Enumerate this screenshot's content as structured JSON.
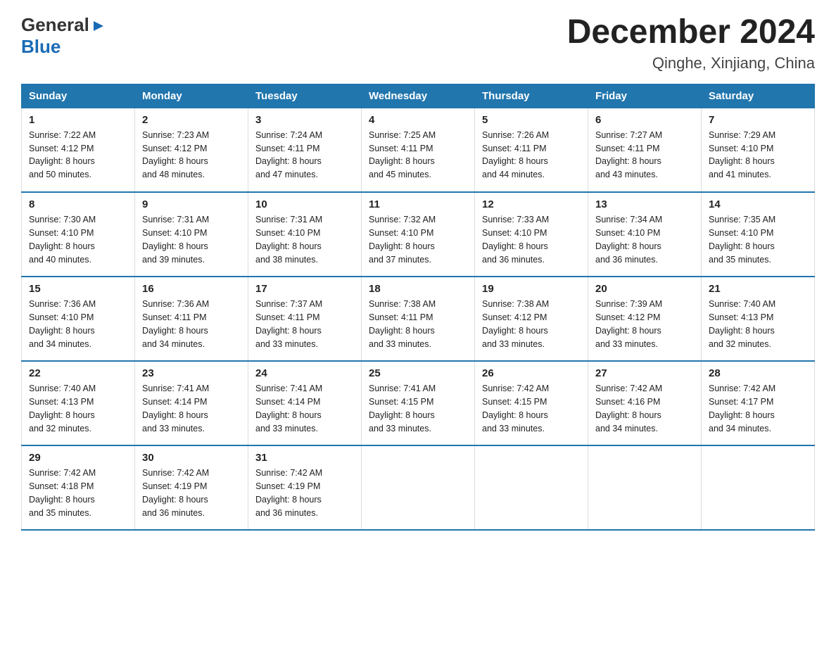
{
  "logo": {
    "general": "General",
    "blue": "Blue",
    "arrow": "▶"
  },
  "title": "December 2024",
  "subtitle": "Qinghe, Xinjiang, China",
  "days_of_week": [
    "Sunday",
    "Monday",
    "Tuesday",
    "Wednesday",
    "Thursday",
    "Friday",
    "Saturday"
  ],
  "weeks": [
    [
      {
        "day": "1",
        "info": "Sunrise: 7:22 AM\nSunset: 4:12 PM\nDaylight: 8 hours\nand 50 minutes."
      },
      {
        "day": "2",
        "info": "Sunrise: 7:23 AM\nSunset: 4:12 PM\nDaylight: 8 hours\nand 48 minutes."
      },
      {
        "day": "3",
        "info": "Sunrise: 7:24 AM\nSunset: 4:11 PM\nDaylight: 8 hours\nand 47 minutes."
      },
      {
        "day": "4",
        "info": "Sunrise: 7:25 AM\nSunset: 4:11 PM\nDaylight: 8 hours\nand 45 minutes."
      },
      {
        "day": "5",
        "info": "Sunrise: 7:26 AM\nSunset: 4:11 PM\nDaylight: 8 hours\nand 44 minutes."
      },
      {
        "day": "6",
        "info": "Sunrise: 7:27 AM\nSunset: 4:11 PM\nDaylight: 8 hours\nand 43 minutes."
      },
      {
        "day": "7",
        "info": "Sunrise: 7:29 AM\nSunset: 4:10 PM\nDaylight: 8 hours\nand 41 minutes."
      }
    ],
    [
      {
        "day": "8",
        "info": "Sunrise: 7:30 AM\nSunset: 4:10 PM\nDaylight: 8 hours\nand 40 minutes."
      },
      {
        "day": "9",
        "info": "Sunrise: 7:31 AM\nSunset: 4:10 PM\nDaylight: 8 hours\nand 39 minutes."
      },
      {
        "day": "10",
        "info": "Sunrise: 7:31 AM\nSunset: 4:10 PM\nDaylight: 8 hours\nand 38 minutes."
      },
      {
        "day": "11",
        "info": "Sunrise: 7:32 AM\nSunset: 4:10 PM\nDaylight: 8 hours\nand 37 minutes."
      },
      {
        "day": "12",
        "info": "Sunrise: 7:33 AM\nSunset: 4:10 PM\nDaylight: 8 hours\nand 36 minutes."
      },
      {
        "day": "13",
        "info": "Sunrise: 7:34 AM\nSunset: 4:10 PM\nDaylight: 8 hours\nand 36 minutes."
      },
      {
        "day": "14",
        "info": "Sunrise: 7:35 AM\nSunset: 4:10 PM\nDaylight: 8 hours\nand 35 minutes."
      }
    ],
    [
      {
        "day": "15",
        "info": "Sunrise: 7:36 AM\nSunset: 4:10 PM\nDaylight: 8 hours\nand 34 minutes."
      },
      {
        "day": "16",
        "info": "Sunrise: 7:36 AM\nSunset: 4:11 PM\nDaylight: 8 hours\nand 34 minutes."
      },
      {
        "day": "17",
        "info": "Sunrise: 7:37 AM\nSunset: 4:11 PM\nDaylight: 8 hours\nand 33 minutes."
      },
      {
        "day": "18",
        "info": "Sunrise: 7:38 AM\nSunset: 4:11 PM\nDaylight: 8 hours\nand 33 minutes."
      },
      {
        "day": "19",
        "info": "Sunrise: 7:38 AM\nSunset: 4:12 PM\nDaylight: 8 hours\nand 33 minutes."
      },
      {
        "day": "20",
        "info": "Sunrise: 7:39 AM\nSunset: 4:12 PM\nDaylight: 8 hours\nand 33 minutes."
      },
      {
        "day": "21",
        "info": "Sunrise: 7:40 AM\nSunset: 4:13 PM\nDaylight: 8 hours\nand 32 minutes."
      }
    ],
    [
      {
        "day": "22",
        "info": "Sunrise: 7:40 AM\nSunset: 4:13 PM\nDaylight: 8 hours\nand 32 minutes."
      },
      {
        "day": "23",
        "info": "Sunrise: 7:41 AM\nSunset: 4:14 PM\nDaylight: 8 hours\nand 33 minutes."
      },
      {
        "day": "24",
        "info": "Sunrise: 7:41 AM\nSunset: 4:14 PM\nDaylight: 8 hours\nand 33 minutes."
      },
      {
        "day": "25",
        "info": "Sunrise: 7:41 AM\nSunset: 4:15 PM\nDaylight: 8 hours\nand 33 minutes."
      },
      {
        "day": "26",
        "info": "Sunrise: 7:42 AM\nSunset: 4:15 PM\nDaylight: 8 hours\nand 33 minutes."
      },
      {
        "day": "27",
        "info": "Sunrise: 7:42 AM\nSunset: 4:16 PM\nDaylight: 8 hours\nand 34 minutes."
      },
      {
        "day": "28",
        "info": "Sunrise: 7:42 AM\nSunset: 4:17 PM\nDaylight: 8 hours\nand 34 minutes."
      }
    ],
    [
      {
        "day": "29",
        "info": "Sunrise: 7:42 AM\nSunset: 4:18 PM\nDaylight: 8 hours\nand 35 minutes."
      },
      {
        "day": "30",
        "info": "Sunrise: 7:42 AM\nSunset: 4:19 PM\nDaylight: 8 hours\nand 36 minutes."
      },
      {
        "day": "31",
        "info": "Sunrise: 7:42 AM\nSunset: 4:19 PM\nDaylight: 8 hours\nand 36 minutes."
      },
      {
        "day": "",
        "info": ""
      },
      {
        "day": "",
        "info": ""
      },
      {
        "day": "",
        "info": ""
      },
      {
        "day": "",
        "info": ""
      }
    ]
  ]
}
